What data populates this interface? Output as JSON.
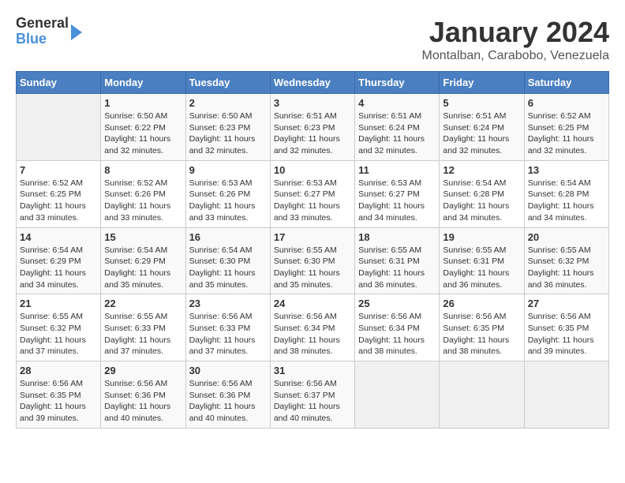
{
  "header": {
    "logo_general": "General",
    "logo_blue": "Blue",
    "month_year": "January 2024",
    "location": "Montalban, Carabobo, Venezuela"
  },
  "days_of_week": [
    "Sunday",
    "Monday",
    "Tuesday",
    "Wednesday",
    "Thursday",
    "Friday",
    "Saturday"
  ],
  "weeks": [
    [
      {
        "day": "",
        "info": ""
      },
      {
        "day": "1",
        "sunrise": "6:50 AM",
        "sunset": "6:22 PM",
        "daylight": "11 hours and 32 minutes."
      },
      {
        "day": "2",
        "sunrise": "6:50 AM",
        "sunset": "6:23 PM",
        "daylight": "11 hours and 32 minutes."
      },
      {
        "day": "3",
        "sunrise": "6:51 AM",
        "sunset": "6:23 PM",
        "daylight": "11 hours and 32 minutes."
      },
      {
        "day": "4",
        "sunrise": "6:51 AM",
        "sunset": "6:24 PM",
        "daylight": "11 hours and 32 minutes."
      },
      {
        "day": "5",
        "sunrise": "6:51 AM",
        "sunset": "6:24 PM",
        "daylight": "11 hours and 32 minutes."
      },
      {
        "day": "6",
        "sunrise": "6:52 AM",
        "sunset": "6:25 PM",
        "daylight": "11 hours and 32 minutes."
      }
    ],
    [
      {
        "day": "7",
        "sunrise": "6:52 AM",
        "sunset": "6:25 PM",
        "daylight": "11 hours and 33 minutes."
      },
      {
        "day": "8",
        "sunrise": "6:52 AM",
        "sunset": "6:26 PM",
        "daylight": "11 hours and 33 minutes."
      },
      {
        "day": "9",
        "sunrise": "6:53 AM",
        "sunset": "6:26 PM",
        "daylight": "11 hours and 33 minutes."
      },
      {
        "day": "10",
        "sunrise": "6:53 AM",
        "sunset": "6:27 PM",
        "daylight": "11 hours and 33 minutes."
      },
      {
        "day": "11",
        "sunrise": "6:53 AM",
        "sunset": "6:27 PM",
        "daylight": "11 hours and 34 minutes."
      },
      {
        "day": "12",
        "sunrise": "6:54 AM",
        "sunset": "6:28 PM",
        "daylight": "11 hours and 34 minutes."
      },
      {
        "day": "13",
        "sunrise": "6:54 AM",
        "sunset": "6:28 PM",
        "daylight": "11 hours and 34 minutes."
      }
    ],
    [
      {
        "day": "14",
        "sunrise": "6:54 AM",
        "sunset": "6:29 PM",
        "daylight": "11 hours and 34 minutes."
      },
      {
        "day": "15",
        "sunrise": "6:54 AM",
        "sunset": "6:29 PM",
        "daylight": "11 hours and 35 minutes."
      },
      {
        "day": "16",
        "sunrise": "6:54 AM",
        "sunset": "6:30 PM",
        "daylight": "11 hours and 35 minutes."
      },
      {
        "day": "17",
        "sunrise": "6:55 AM",
        "sunset": "6:30 PM",
        "daylight": "11 hours and 35 minutes."
      },
      {
        "day": "18",
        "sunrise": "6:55 AM",
        "sunset": "6:31 PM",
        "daylight": "11 hours and 36 minutes."
      },
      {
        "day": "19",
        "sunrise": "6:55 AM",
        "sunset": "6:31 PM",
        "daylight": "11 hours and 36 minutes."
      },
      {
        "day": "20",
        "sunrise": "6:55 AM",
        "sunset": "6:32 PM",
        "daylight": "11 hours and 36 minutes."
      }
    ],
    [
      {
        "day": "21",
        "sunrise": "6:55 AM",
        "sunset": "6:32 PM",
        "daylight": "11 hours and 37 minutes."
      },
      {
        "day": "22",
        "sunrise": "6:55 AM",
        "sunset": "6:33 PM",
        "daylight": "11 hours and 37 minutes."
      },
      {
        "day": "23",
        "sunrise": "6:56 AM",
        "sunset": "6:33 PM",
        "daylight": "11 hours and 37 minutes."
      },
      {
        "day": "24",
        "sunrise": "6:56 AM",
        "sunset": "6:34 PM",
        "daylight": "11 hours and 38 minutes."
      },
      {
        "day": "25",
        "sunrise": "6:56 AM",
        "sunset": "6:34 PM",
        "daylight": "11 hours and 38 minutes."
      },
      {
        "day": "26",
        "sunrise": "6:56 AM",
        "sunset": "6:35 PM",
        "daylight": "11 hours and 38 minutes."
      },
      {
        "day": "27",
        "sunrise": "6:56 AM",
        "sunset": "6:35 PM",
        "daylight": "11 hours and 39 minutes."
      }
    ],
    [
      {
        "day": "28",
        "sunrise": "6:56 AM",
        "sunset": "6:35 PM",
        "daylight": "11 hours and 39 minutes."
      },
      {
        "day": "29",
        "sunrise": "6:56 AM",
        "sunset": "6:36 PM",
        "daylight": "11 hours and 40 minutes."
      },
      {
        "day": "30",
        "sunrise": "6:56 AM",
        "sunset": "6:36 PM",
        "daylight": "11 hours and 40 minutes."
      },
      {
        "day": "31",
        "sunrise": "6:56 AM",
        "sunset": "6:37 PM",
        "daylight": "11 hours and 40 minutes."
      },
      {
        "day": "",
        "info": ""
      },
      {
        "day": "",
        "info": ""
      },
      {
        "day": "",
        "info": ""
      }
    ]
  ]
}
